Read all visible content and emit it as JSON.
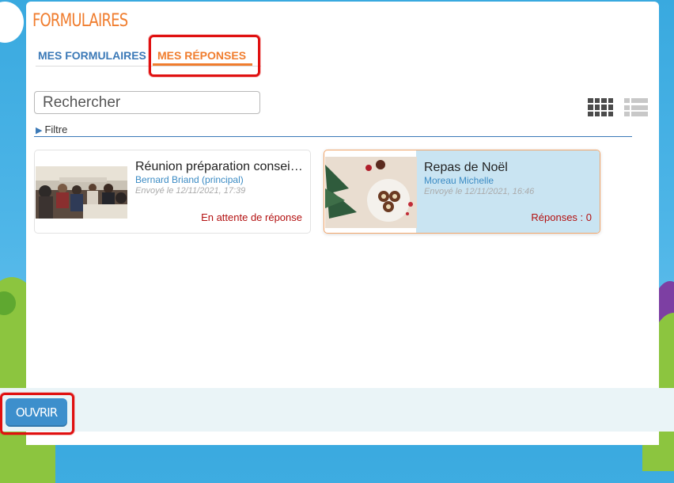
{
  "app": {
    "title": "FORMULAIRES"
  },
  "tabs": [
    {
      "label": "MES FORMULAIRES",
      "active": false
    },
    {
      "label": "MES RÉPONSES",
      "active": true
    }
  ],
  "search": {
    "placeholder": "Rechercher",
    "value": ""
  },
  "view_toggle": {
    "icons": [
      "grid-view-icon",
      "list-view-icon"
    ],
    "selected": "grid"
  },
  "filter": {
    "label": "Filtre",
    "icon": "triangle-right-icon"
  },
  "cards": [
    {
      "title": "Réunion préparation conseil d'école",
      "author": "Bernard Briand (principal)",
      "date": "Envoyé le 12/11/2021, 17:39",
      "status": "En attente de réponse",
      "selected": false
    },
    {
      "title": "Repas de Noël",
      "author": "Moreau Michelle",
      "date": "Envoyé le 12/11/2021, 16:46",
      "status": "Réponses : 0",
      "selected": true
    }
  ],
  "footer": {
    "open_label": "OUVRIR"
  },
  "colors": {
    "accent": "#f07d2e",
    "link": "#3b79b7",
    "selected_card": "#c9e4f2",
    "status": "#b31010",
    "annotation": "#e01010"
  }
}
